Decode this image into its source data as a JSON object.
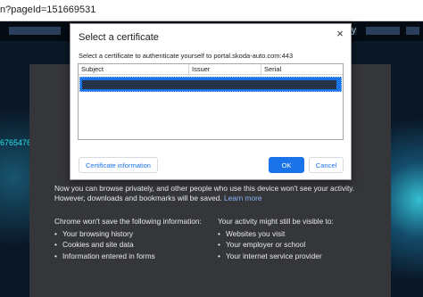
{
  "browser": {
    "url_fragment": "n?pageId=151669531"
  },
  "background": {
    "top_strip_right_text": "y",
    "side_code": "6765476"
  },
  "incognito": {
    "intro_text": "Now you can browse privately, and other people who use this device won't see your activity. However, downloads and bookmarks will be saved.",
    "learn_more": "Learn more",
    "wont_save": {
      "heading": "Chrome won't save the following information:",
      "items": [
        "Your browsing history",
        "Cookies and site data",
        "Information entered in forms"
      ]
    },
    "might_be_visible": {
      "heading": "Your activity might still be visible to:",
      "items": [
        "Websites you visit",
        "Your employer or school",
        "Your internet service provider"
      ]
    }
  },
  "dialog": {
    "title": "Select a certificate",
    "close_glyph": "×",
    "subtitle": "Select a certificate to authenticate yourself to portal.skoda-auto.com:443",
    "columns": [
      "Subject",
      "Issuer",
      "Serial"
    ],
    "buttons": {
      "info": "Certificate information",
      "ok": "OK",
      "cancel": "Cancel"
    }
  },
  "colors": {
    "accent": "#1a73e8",
    "incognito_bg": "#35363a",
    "link": "#8ab4f8"
  }
}
